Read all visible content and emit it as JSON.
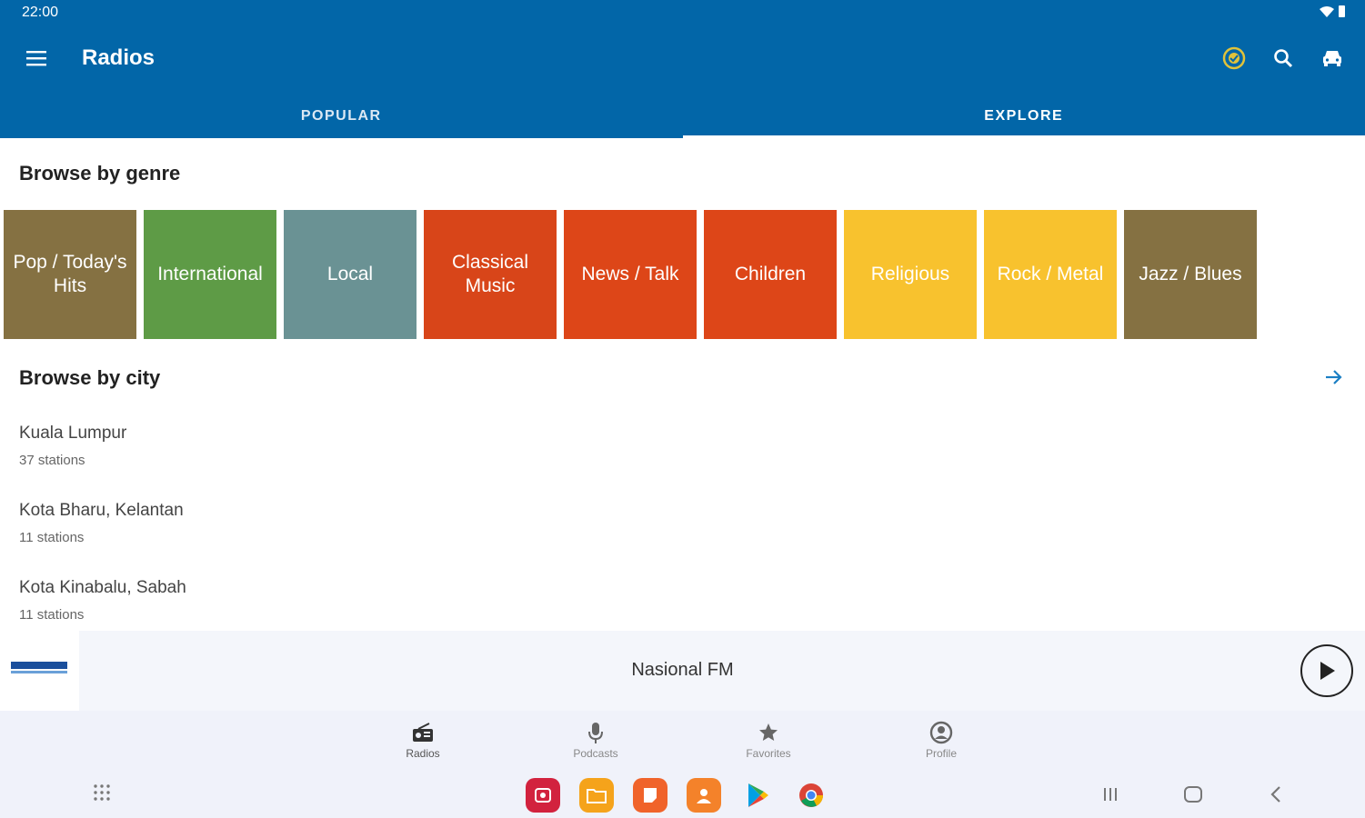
{
  "status_bar": {
    "time": "22:00"
  },
  "app_bar": {
    "title": "Radios"
  },
  "tabs": [
    {
      "label": "POPULAR",
      "active": false
    },
    {
      "label": "EXPLORE",
      "active": true
    }
  ],
  "genres_section": {
    "title": "Browse by genre",
    "items": [
      {
        "label": "Pop / Today's Hits",
        "color": "#857142"
      },
      {
        "label": "International",
        "color": "#5e9b46"
      },
      {
        "label": "Local",
        "color": "#6a9294"
      },
      {
        "label": "Classical Music",
        "color": "#d84519"
      },
      {
        "label": "News / Talk",
        "color": "#dd4618"
      },
      {
        "label": "Children",
        "color": "#dd4618"
      },
      {
        "label": "Religious",
        "color": "#f8c22e"
      },
      {
        "label": "Rock / Metal",
        "color": "#f8c22e"
      },
      {
        "label": "Jazz / Blues",
        "color": "#857142"
      }
    ]
  },
  "cities_section": {
    "title": "Browse by city",
    "items": [
      {
        "name": "Kuala Lumpur",
        "count": "37 stations"
      },
      {
        "name": "Kota Bharu, Kelantan",
        "count": "11 stations"
      },
      {
        "name": "Kota Kinabalu, Sabah",
        "count": "11 stations"
      }
    ]
  },
  "player": {
    "station": "Nasional FM"
  },
  "bottom_nav": [
    {
      "label": "Radios",
      "icon": "radio-icon",
      "active": true
    },
    {
      "label": "Podcasts",
      "icon": "microphone-icon",
      "active": false
    },
    {
      "label": "Favorites",
      "icon": "star-icon",
      "active": false
    },
    {
      "label": "Profile",
      "icon": "profile-icon",
      "active": false
    }
  ],
  "theme": {
    "primary": "#0266a8",
    "premium_badge": "#e0c23a"
  }
}
